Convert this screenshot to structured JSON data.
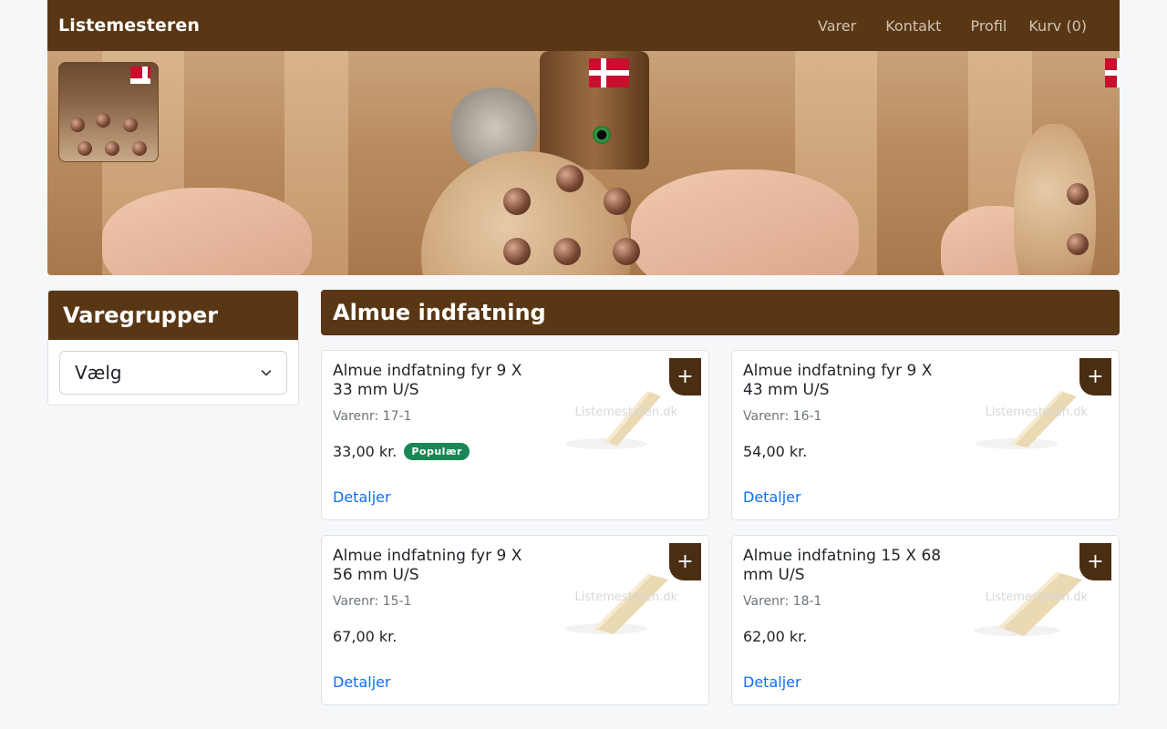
{
  "navbar": {
    "brand": "Listemesteren",
    "links": [
      "Varer",
      "Kontakt",
      "Profil"
    ],
    "cart": "Kurv (0)"
  },
  "sidebar": {
    "title": "Varegrupper",
    "select_value": "Vælg"
  },
  "main": {
    "title": "Almue indfatning",
    "products": [
      {
        "name": "Almue indfatning fyr 9 X 33 mm U/S",
        "sku": "Varenr: 17-1",
        "price": "33,00 kr.",
        "badge": "Populær",
        "details": "Detaljer",
        "add": "+",
        "watermark": "Listemesteren.dk"
      },
      {
        "name": "Almue indfatning fyr 9 X 43 mm U/S",
        "sku": "Varenr: 16-1",
        "price": "54,00 kr.",
        "badge": "",
        "details": "Detaljer",
        "add": "+",
        "watermark": "Listemesteren.dk"
      },
      {
        "name": "Almue indfatning fyr 9 X 56 mm U/S",
        "sku": "Varenr: 15-1",
        "price": "67,00 kr.",
        "badge": "",
        "details": "Detaljer",
        "add": "+",
        "watermark": "Listemesteren.dk"
      },
      {
        "name": "Almue indfatning 15 X 68 mm U/S",
        "sku": "Varenr: 18-1",
        "price": "62,00 kr.",
        "badge": "",
        "details": "Detaljer",
        "add": "+",
        "watermark": "Listemesteren.dk"
      }
    ]
  },
  "colors": {
    "brand_brown": "#5a3714",
    "add_button": "#4a2e12",
    "badge_green": "#198754",
    "link_blue": "#0d6efd"
  },
  "icons": {
    "select_chevron": "chevron-down-icon",
    "add": "plus-icon"
  }
}
